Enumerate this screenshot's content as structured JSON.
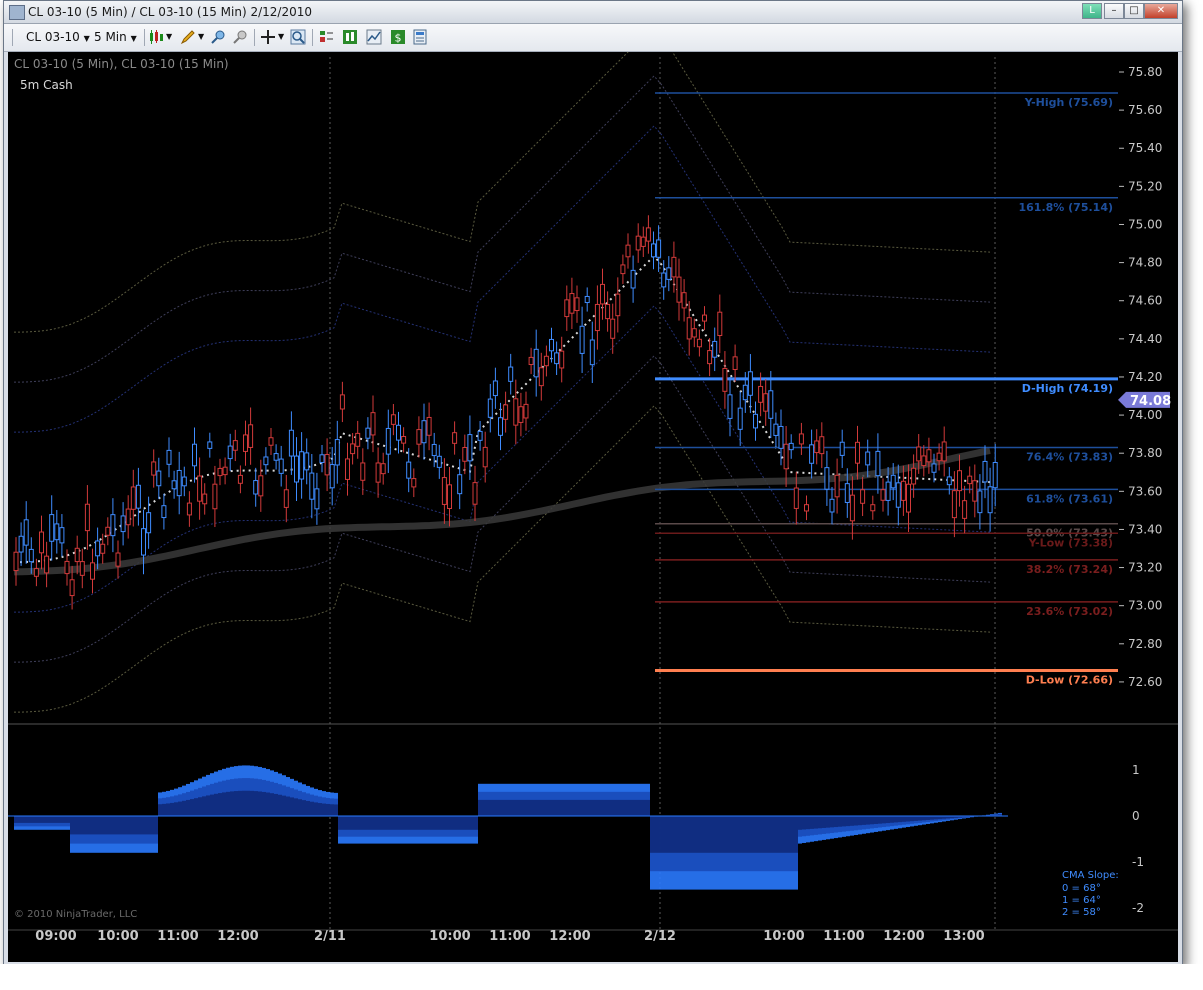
{
  "window": {
    "title": "CL 03-10 (5 Min) / CL 03-10 (15 Min)  2/12/2010",
    "controls": [
      "L",
      "min",
      "max",
      "close"
    ]
  },
  "toolbar": {
    "instrument": "CL 03-10",
    "period": "5 Min",
    "icons": [
      "candlestick-style-icon",
      "pencil-draw-icon",
      "zoom-in-icon",
      "pin-icon",
      "crosshair-icon",
      "magnifier-icon",
      "data-box-icon",
      "chart-trader-icon",
      "strategy-icon",
      "dollar-icon",
      "properties-icon"
    ]
  },
  "chart": {
    "header": "CL 03-10 (5 Min), CL 03-10 (15 Min)",
    "subheader": "5m Cash",
    "copyright": "© 2010 NinjaTrader, LLC",
    "current_price": "74.08",
    "price_axis": [
      "75.80",
      "75.60",
      "75.40",
      "75.20",
      "75.00",
      "74.80",
      "74.60",
      "74.40",
      "74.20",
      "74.00",
      "73.80",
      "73.60",
      "73.40",
      "73.20",
      "73.00",
      "72.80",
      "72.60"
    ],
    "time_axis": [
      "09:00",
      "10:00",
      "11:00",
      "12:00",
      "2/11",
      "10:00",
      "11:00",
      "12:00",
      "2/12",
      "10:00",
      "11:00",
      "12:00",
      "13:00"
    ],
    "levels": [
      {
        "label": "Y-High (75.69)",
        "value": 75.69,
        "color": "#1e4f9c"
      },
      {
        "label": "161.8% (75.14)",
        "value": 75.14,
        "color": "#1e4f9c"
      },
      {
        "label": "D-High (74.19)",
        "value": 74.19,
        "color": "#3f8cff"
      },
      {
        "label": "76.4% (73.83)",
        "value": 73.83,
        "color": "#1e4f9c"
      },
      {
        "label": "61.8% (73.61)",
        "value": 73.61,
        "color": "#1e4f9c"
      },
      {
        "label": "50.0% (73.43)",
        "value": 73.43,
        "color": "#5a4a4a"
      },
      {
        "label": "Y-Low (73.38)",
        "value": 73.38,
        "color": "#6a1a1a"
      },
      {
        "label": "38.2% (73.24)",
        "value": 73.24,
        "color": "#7a1e1e"
      },
      {
        "label": "23.6% (73.02)",
        "value": 73.02,
        "color": "#7a1e1e"
      },
      {
        "label": "D-Low (72.66)",
        "value": 72.66,
        "color": "#ff7f50"
      }
    ],
    "lower_axis": [
      "1",
      "0",
      "-1",
      "-2"
    ],
    "legend_title": "CMA Slope:",
    "legend_items": [
      "0 = 68°",
      "1 = 64°",
      "2 = 58°"
    ]
  }
}
